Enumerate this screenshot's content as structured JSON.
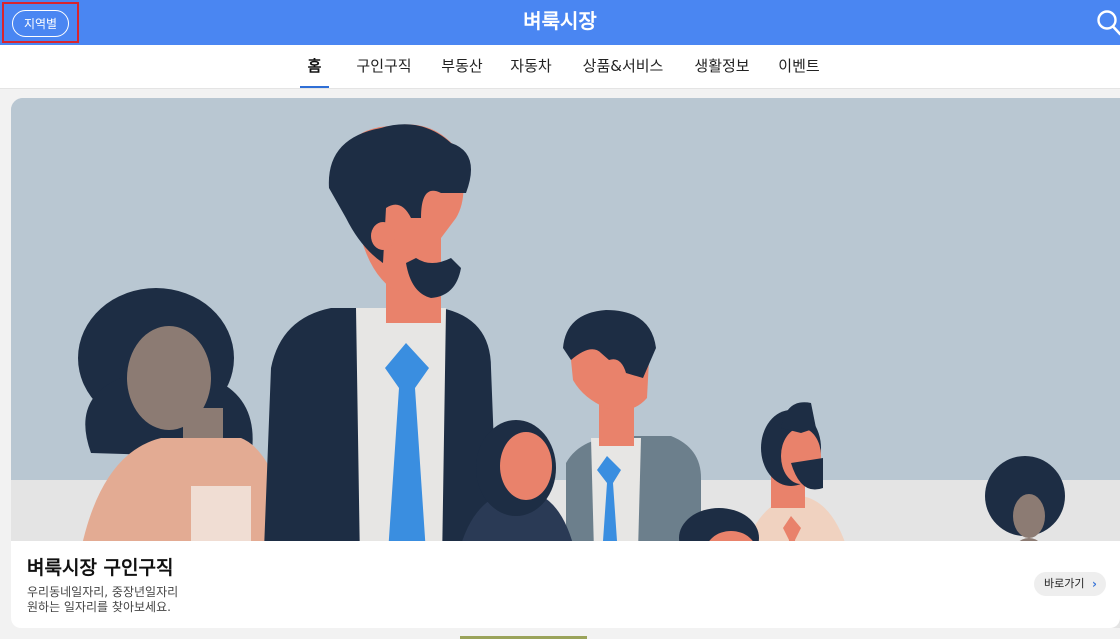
{
  "header": {
    "region_label": "지역별",
    "title": "벼룩시장",
    "search_icon": "search-icon"
  },
  "nav": {
    "tabs": [
      {
        "label": "홈",
        "active": true
      },
      {
        "label": "구인구직",
        "active": false
      },
      {
        "label": "부동산",
        "active": false
      },
      {
        "label": "자동차",
        "active": false
      },
      {
        "label": "상품&서비스",
        "active": false
      },
      {
        "label": "생활정보",
        "active": false
      },
      {
        "label": "이벤트",
        "active": false
      }
    ]
  },
  "banner": {
    "title": "벼룩시장 구인구직",
    "line1": "우리동네일자리, 중장년일자리",
    "line2": "원하는 일자리를 찾아보세요.",
    "button_label": "바로가기",
    "button_icon": "chevron-right-icon"
  },
  "colors": {
    "header_bg": "#4a86f2",
    "active_tab_underline": "#2f6fd6",
    "highlight_border": "#d9252e",
    "hero_bg": "#b9c7d2"
  }
}
